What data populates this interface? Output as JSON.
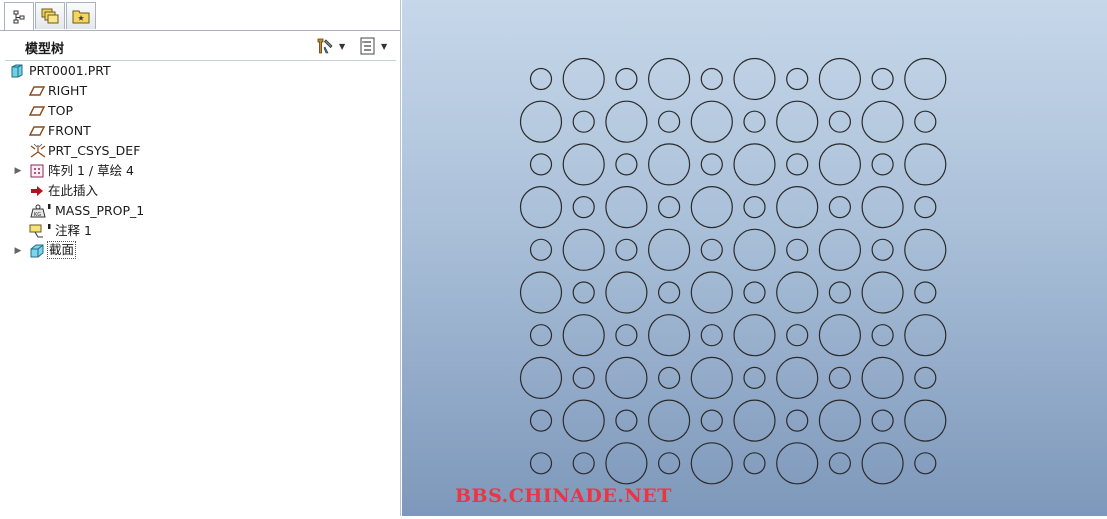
{
  "tabs": [
    {
      "name": "model-tree-tab",
      "icon": "model-tree-icon",
      "active": true
    },
    {
      "name": "layers-tab",
      "icon": "layers-icon",
      "active": false
    },
    {
      "name": "favorites-tab",
      "icon": "favorites-folder-icon",
      "active": false
    }
  ],
  "model_tree": {
    "title": "模型树",
    "settings_icon": "tree-settings-icon",
    "show_icon": "tree-show-icon"
  },
  "tree_items": [
    {
      "label": "PRT0001.PRT",
      "icon": "part-icon"
    },
    {
      "label": "RIGHT",
      "icon": "datum-plane-icon"
    },
    {
      "label": "TOP",
      "icon": "datum-plane-icon"
    },
    {
      "label": "FRONT",
      "icon": "datum-plane-icon"
    },
    {
      "label": "PRT_CSYS_DEF",
      "icon": "coordinate-system-icon"
    },
    {
      "label": "阵列 1 / 草绘 4",
      "icon": "pattern-icon"
    },
    {
      "label": "在此插入",
      "icon": "insert-here-arrow-icon"
    },
    {
      "label": "MASS_PROP_1",
      "icon": "mass-properties-icon"
    },
    {
      "label": "注释 1",
      "icon": "annotation-icon"
    },
    {
      "label": "截面",
      "icon": "section-icon"
    }
  ],
  "viewport": {
    "colors": {
      "bg_top": "#c6d7e9",
      "bg_bottom": "#7e98bb",
      "stroke": "#2a2a2a"
    }
  },
  "watermark": "BBS.CHINADE.NET"
}
